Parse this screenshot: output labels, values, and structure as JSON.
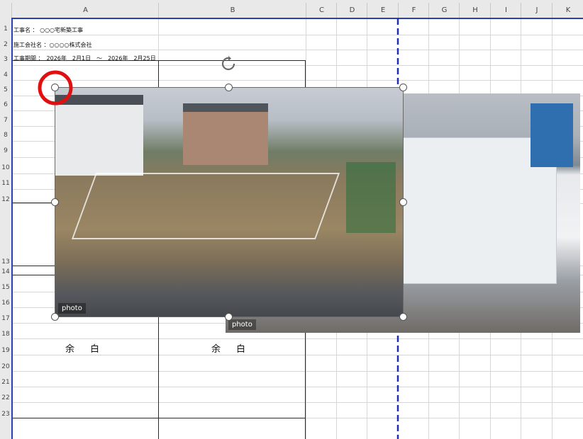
{
  "columns": [
    "A",
    "B",
    "C",
    "D",
    "E",
    "F",
    "G",
    "H",
    "I",
    "J",
    "K"
  ],
  "rows": [
    "1",
    "2",
    "3",
    "4",
    "5",
    "6",
    "7",
    "8",
    "9",
    "10",
    "11",
    "12",
    "13",
    "14",
    "15",
    "16",
    "17",
    "18",
    "19",
    "20",
    "21",
    "22",
    "23"
  ],
  "header_cells": {
    "a1": "工事名 ： ○○○宅新築工事",
    "a2": "施工会社名 ：○○○○株式会社",
    "a3": "工事期間 ：　2026年　2月1日　～　2026年　2月25日"
  },
  "blank_labels": [
    "余白",
    "余白"
  ],
  "photos": {
    "selected": "photo",
    "behind": "photo"
  },
  "icons": {
    "rotate": "rotate-handle-icon",
    "highlight": "red-circle-highlight"
  },
  "colors": {
    "page_break": "#1f2fb0",
    "highlight": "#e01010"
  }
}
